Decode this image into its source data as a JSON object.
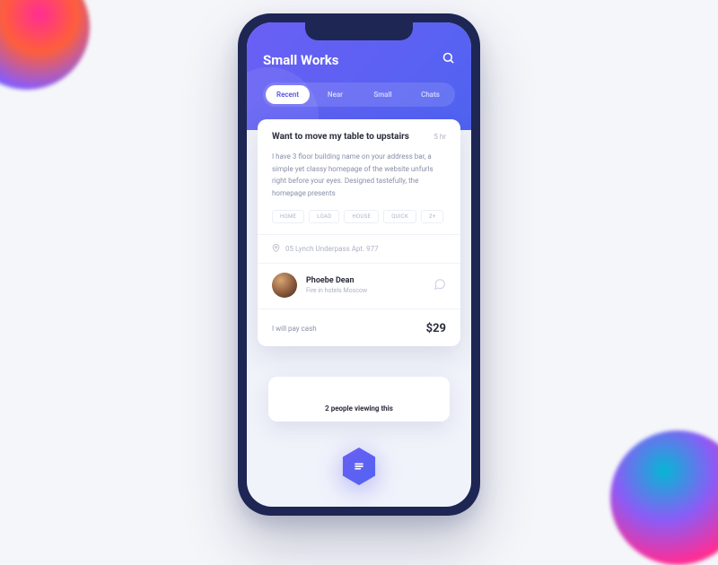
{
  "app_title": "Small Works",
  "tabs": [
    {
      "label": "Recent",
      "active": true
    },
    {
      "label": "Near",
      "active": false
    },
    {
      "label": "Small",
      "active": false
    },
    {
      "label": "Chats",
      "active": false
    }
  ],
  "card": {
    "title": "Want to move my table to upstairs",
    "time": "5 hr",
    "description": "I have 3 floor building name on your address bar, a simple yet classy homepage of the website unfurls right before your eyes. Designed tastefully, the homepage presents",
    "tags": [
      "HOME",
      "LOAD",
      "HOUSE",
      "QUICK",
      "2+"
    ],
    "location": "05 Lynch Underpass Apt. 977",
    "user": {
      "name": "Phoebe Dean",
      "subtitle": "Fire in hotels Moscow"
    },
    "payment": {
      "label": "I will pay cash",
      "amount": "$29"
    }
  },
  "viewing_text": "2 people viewing this"
}
